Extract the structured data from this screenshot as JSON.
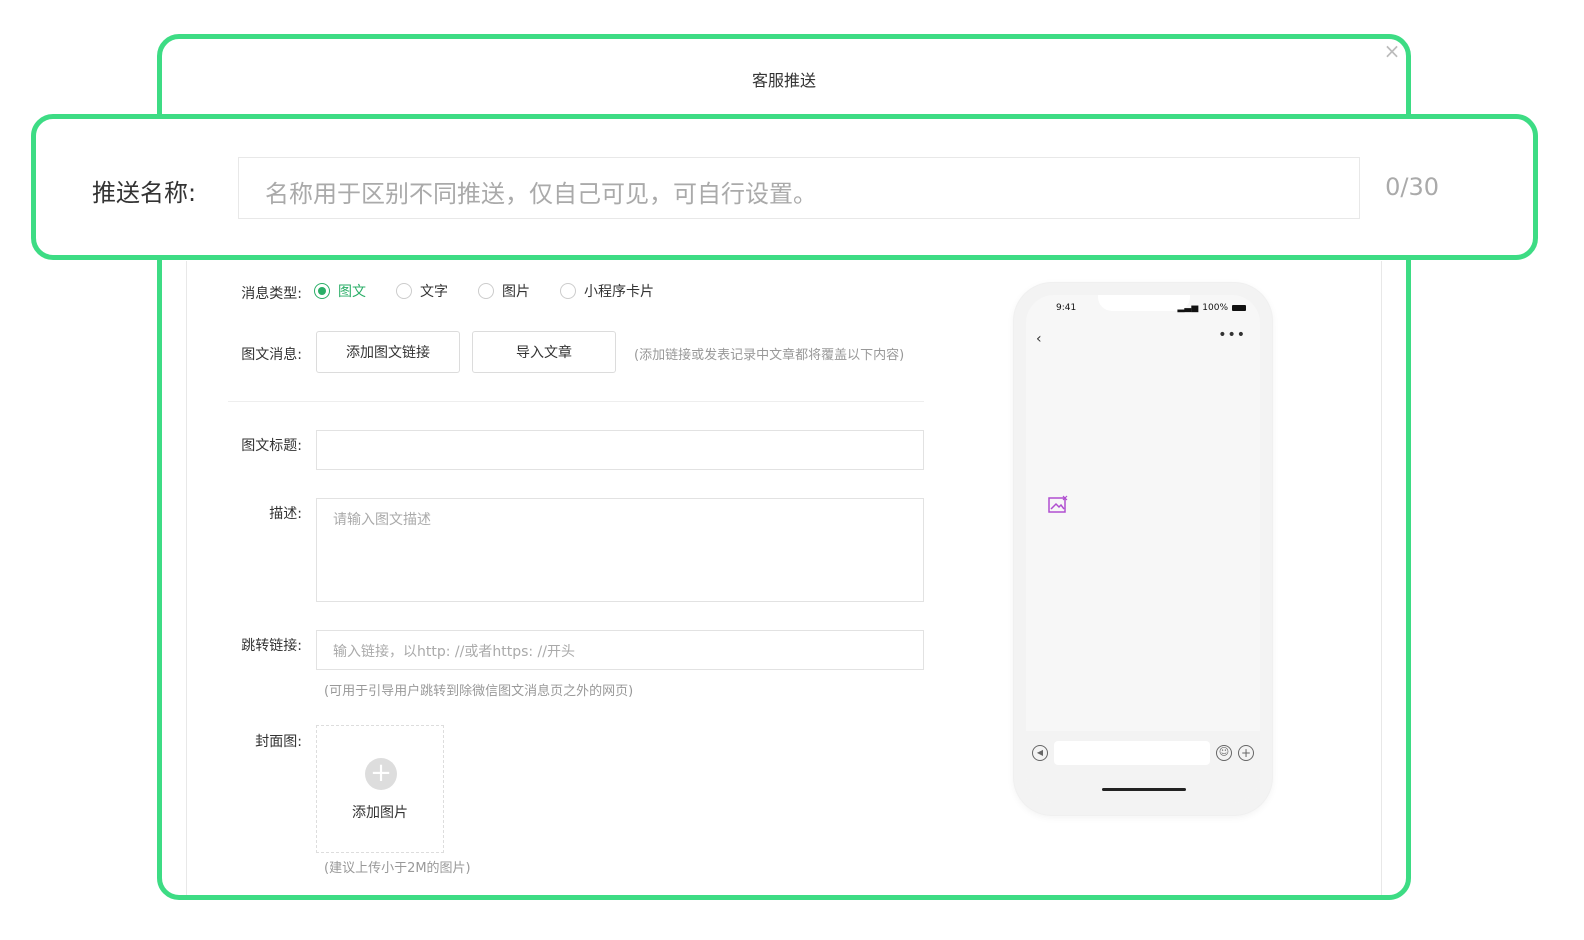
{
  "modal": {
    "title": "客服推送",
    "close_icon": "close-icon"
  },
  "push_name": {
    "label": "推送名称:",
    "placeholder": "名称用于区别不同推送，仅自己可见，可自行设置。",
    "counter": "0/30"
  },
  "message_type": {
    "label": "消息类型:",
    "options": [
      {
        "label": "图文",
        "checked": true
      },
      {
        "label": "文字",
        "checked": false
      },
      {
        "label": "图片",
        "checked": false
      },
      {
        "label": "小程序卡片",
        "checked": false
      }
    ]
  },
  "article_message": {
    "label": "图文消息:",
    "add_link_button": "添加图文链接",
    "import_button": "导入文章",
    "hint": "(添加链接或发表记录中文章都将覆盖以下内容)"
  },
  "article_title": {
    "label": "图文标题:",
    "value": ""
  },
  "description": {
    "label": "描述:",
    "placeholder": "请输入图文描述"
  },
  "jump_link": {
    "label": "跳转链接:",
    "placeholder": "输入链接，以http: //或者https: //开头",
    "hint": "(可用于引导用户跳转到除微信图文消息页之外的网页)"
  },
  "cover": {
    "label": "封面图:",
    "add_text": "添加图片",
    "hint": "(建议上传小于2M的图片)"
  },
  "phone_preview": {
    "time": "9:41",
    "battery": "100%"
  },
  "colors": {
    "accent": "#3ddc84",
    "radio_checked": "#2aae67"
  }
}
